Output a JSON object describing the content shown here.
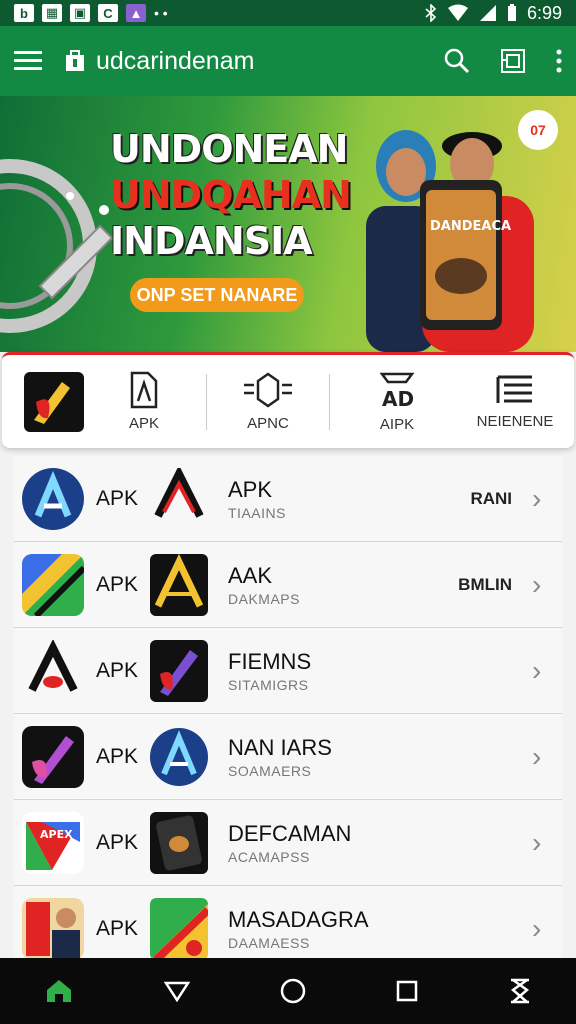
{
  "status_bar": {
    "time": "6:99"
  },
  "app_bar": {
    "title": "udcarindenam",
    "menu_icon": "menu-icon",
    "search_icon": "search-icon",
    "apps_icon": "apps-icon",
    "more_icon": "more-vert-icon"
  },
  "banner": {
    "line1": "UNDONEAN",
    "line2": "UNDQAHAN",
    "line3": "INDANSIA",
    "cta": "ONP SET NANARE",
    "badge": "07",
    "phone_text": "DANDEACA",
    "colors": {
      "green": "#138a44",
      "red": "#e8301e",
      "orange": "#f29a1a"
    }
  },
  "categories": [
    {
      "label": "",
      "icon": "app-logo-icon"
    },
    {
      "label": "APK",
      "icon": "file-icon"
    },
    {
      "label": "APNC",
      "icon": "gear-icon"
    },
    {
      "label": "AIPK",
      "icon": "ad-icon"
    },
    {
      "label": "NEIENENE",
      "icon": "list-icon"
    }
  ],
  "list": [
    {
      "apk": "APK",
      "name": "APK",
      "sub": "TIAAINS",
      "tag": "RANI"
    },
    {
      "apk": "APK",
      "name": "AAK",
      "sub": "DAKMAPS",
      "tag": "BMLIN"
    },
    {
      "apk": "APK",
      "name": "FIEMNS",
      "sub": "SITAMIGRS",
      "tag": ""
    },
    {
      "apk": "APK",
      "name": "NAN IARS",
      "sub": "SOAMAERS",
      "tag": ""
    },
    {
      "apk": "APK",
      "name": "DEFCAMAN",
      "sub": "ACAMAPSS",
      "tag": ""
    },
    {
      "apk": "APK",
      "name": "MASADAGRA",
      "sub": "DAAMAESS",
      "tag": ""
    }
  ],
  "nav": [
    "home-icon",
    "back-icon",
    "circle-home-icon",
    "recents-icon",
    "hourglass-icon"
  ]
}
